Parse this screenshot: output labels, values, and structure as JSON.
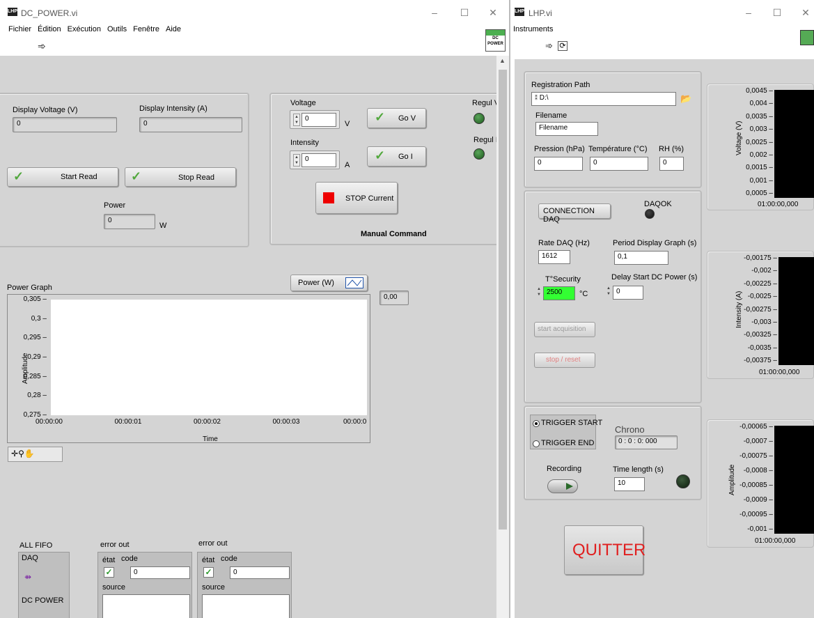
{
  "left_window": {
    "title": "DC_POWER.vi",
    "menu": [
      "Fichier",
      "Édition",
      "Exécution",
      "Outils",
      "Fenêtre",
      "Aide"
    ],
    "icon_text": [
      "DC",
      "POWER"
    ],
    "display_voltage": {
      "label": "Display Voltage (V)",
      "value": "0"
    },
    "display_intensity": {
      "label": "Display Intensity (A)",
      "value": "0"
    },
    "start_read": "Start Read",
    "stop_read": "Stop Read",
    "power": {
      "label": "Power",
      "value": "0",
      "unit": "W"
    },
    "voltage": {
      "label": "Voltage",
      "value": "0",
      "unit": "V"
    },
    "intensity": {
      "label": "Intensity",
      "value": "0",
      "unit": "A"
    },
    "go_v": "Go V",
    "go_i": "Go I",
    "regul_v": "Regul V",
    "regul_i": "Regul I",
    "stop_current": "STOP Current",
    "manual_command": "Manual Command",
    "power_legend": "Power (W)",
    "graph_value": "0,00",
    "graph": {
      "title": "Power  Graph",
      "ylabel": "Amplitude",
      "xlabel": "Time",
      "yticks": [
        "0,305",
        "0,3",
        "0,295",
        "0,29",
        "0,285",
        "0,28",
        "0,275"
      ],
      "xticks": [
        "00:00:00",
        "00:00:01",
        "00:00:02",
        "00:00:03",
        "00:00:0"
      ]
    },
    "all_fifo": "ALL FIFO",
    "fifo_items": [
      "DAQ",
      "DC POWER"
    ],
    "error_out_1": {
      "label": "error out",
      "etat": "état",
      "code_label": "code",
      "code": "0",
      "source": "source"
    },
    "error_out_2": {
      "label": "error out",
      "etat": "état",
      "code_label": "code",
      "code": "0",
      "source": "source"
    }
  },
  "right_window": {
    "title": "LHP.vi",
    "menu": [
      "Instruments"
    ],
    "registration_path": {
      "label": "Registration Path",
      "value": "D:\\"
    },
    "filename": {
      "label": "Filename",
      "value": "Filename"
    },
    "pression": {
      "label": "Pression (hPa)",
      "value": "0"
    },
    "temperature": {
      "label": "Température (°C)",
      "value": "0"
    },
    "rh": {
      "label": "RH (%)",
      "value": "0"
    },
    "connection_daq": "CONNECTION DAQ",
    "daqok": "DAQOK",
    "rate_daq": {
      "label": "Rate DAQ (Hz)",
      "value": "1612"
    },
    "period_display": {
      "label": "Period Display Graph (s)",
      "value": "0,1"
    },
    "t_security": {
      "label": "T°Security",
      "value": "2500",
      "unit": "°C"
    },
    "delay_start": {
      "label": "Delay Start DC Power (s)",
      "value": "0"
    },
    "start_acquisition": "start acquisition",
    "stop_reset": "stop / reset",
    "trigger_start": "TRIGGER START",
    "trigger_end": "TRIGGER END",
    "chrono": {
      "label": "Chrono",
      "value": "0 : 0 : 0: 000"
    },
    "recording": "Recording",
    "time_length": {
      "label": "Time length (s)",
      "value": "10"
    },
    "quitter": "QUITTER",
    "voltage_graph": {
      "ylabel": "Voltage (V)",
      "yticks": [
        "0,0045",
        "0,004",
        "0,0035",
        "0,003",
        "0,0025",
        "0,002",
        "0,0015",
        "0,001",
        "0,0005"
      ],
      "xtick": "01:00:00,000"
    },
    "intensity_graph": {
      "ylabel": "Intensity (A)",
      "yticks": [
        "-0,00175",
        "-0,002",
        "-0,00225",
        "-0,0025",
        "-0,00275",
        "-0,003",
        "-0,00325",
        "-0,0035",
        "-0,00375"
      ],
      "xtick": "01:00:00,000"
    },
    "amplitude_graph": {
      "ylabel": "Amplitude",
      "yticks": [
        "-0,00065",
        "-0,0007",
        "-0,00075",
        "-0,0008",
        "-0,00085",
        "-0,0009",
        "-0,00095",
        "-0,001"
      ],
      "xtick": "01:00:00,000"
    }
  },
  "colors": {
    "panel": "#d4d4d4",
    "led_green": "#3a8a3a",
    "stop_red": "#ee0000",
    "quitter_text": "#e02020",
    "tsec_bg": "#33ff33"
  }
}
